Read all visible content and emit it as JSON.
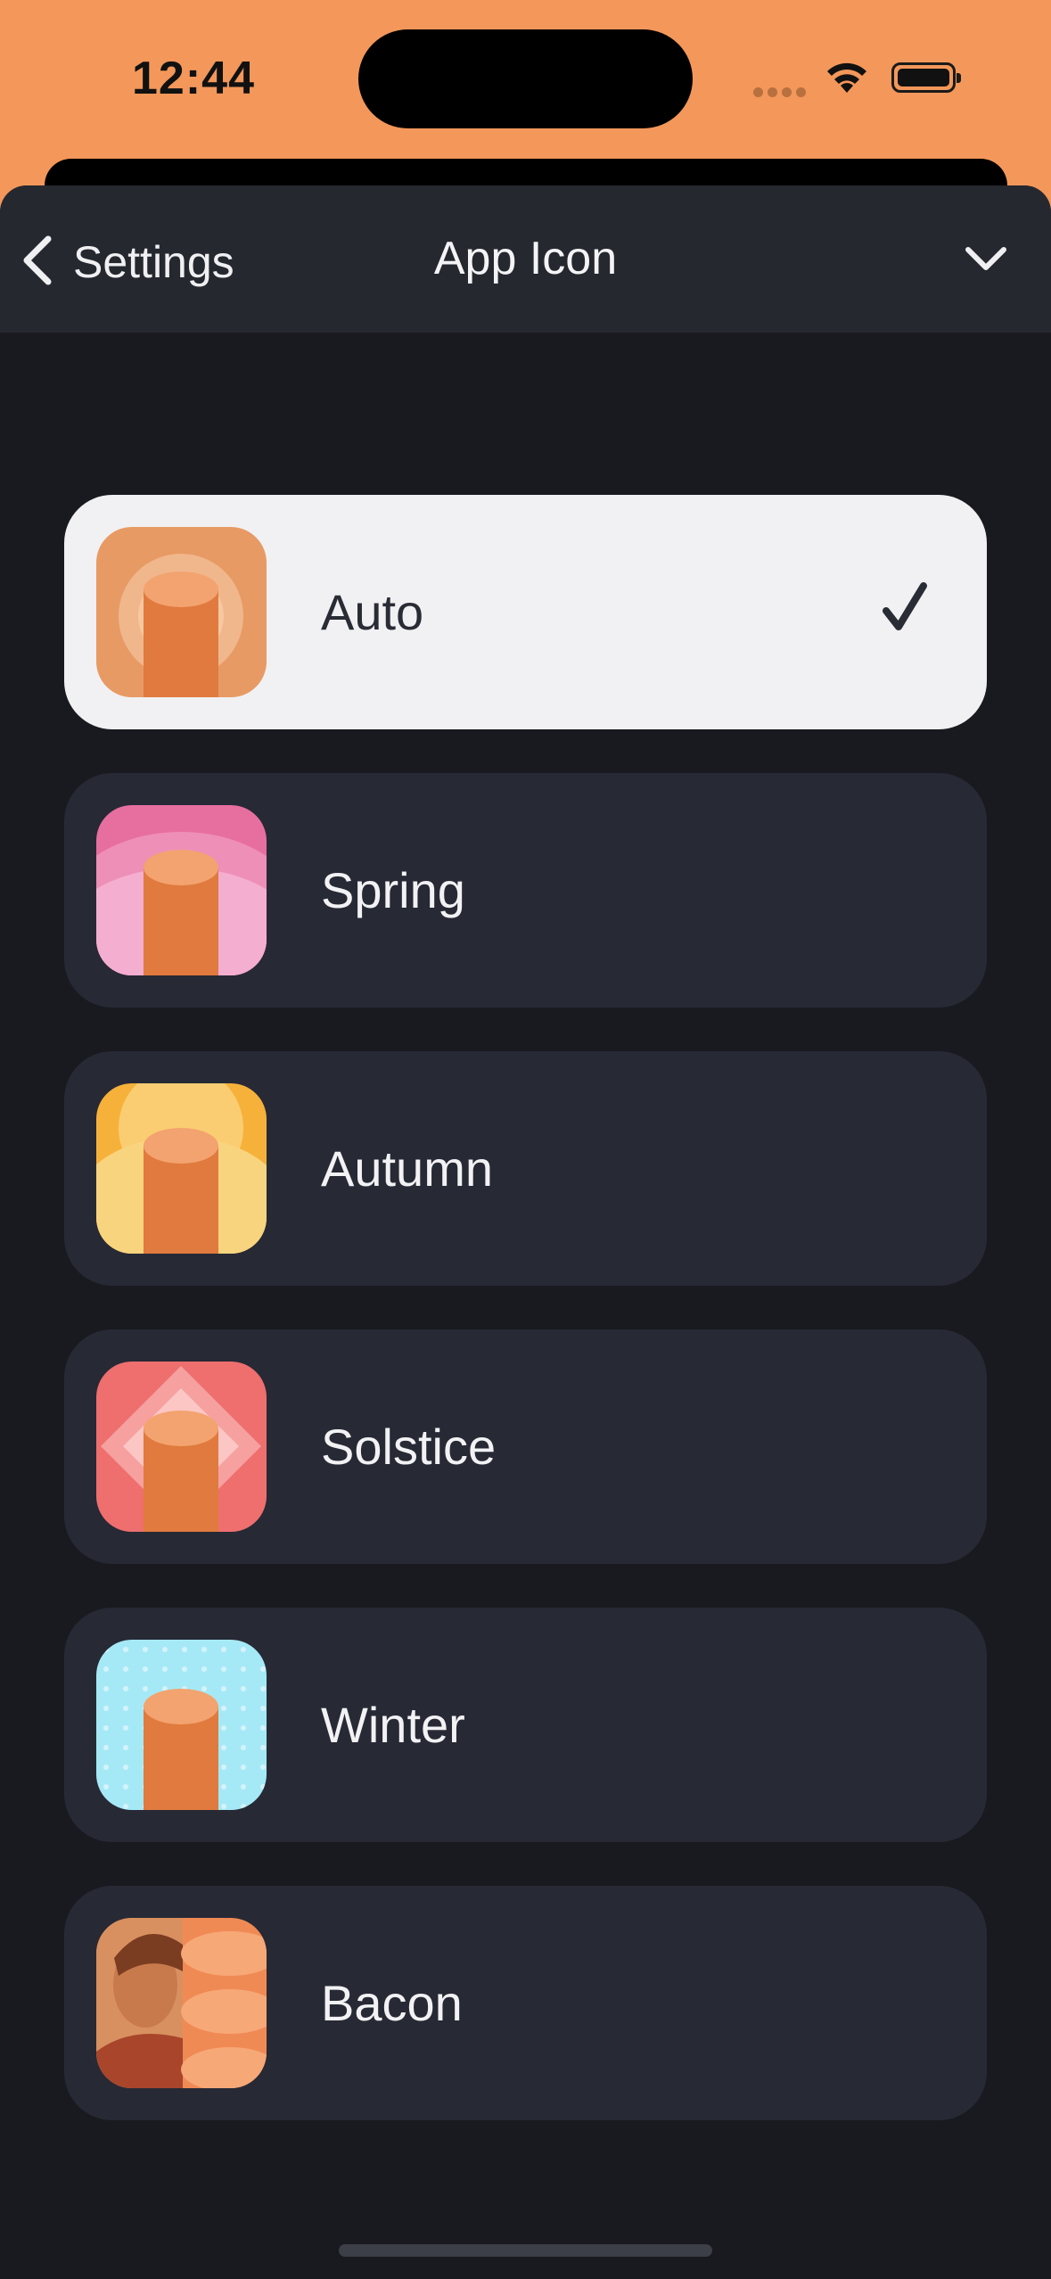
{
  "status_bar": {
    "time": "12:44",
    "icons": [
      "signal-dots-icon",
      "wifi-icon",
      "battery-icon"
    ]
  },
  "nav": {
    "back_label": "Settings",
    "title": "App Icon",
    "back_icon": "chevron-left-icon",
    "collapse_icon": "chevron-down-icon"
  },
  "options": [
    {
      "label": "Auto",
      "selected": true,
      "icon": "auto-app-icon"
    },
    {
      "label": "Spring",
      "selected": false,
      "icon": "spring-app-icon"
    },
    {
      "label": "Autumn",
      "selected": false,
      "icon": "autumn-app-icon"
    },
    {
      "label": "Solstice",
      "selected": false,
      "icon": "solstice-app-icon"
    },
    {
      "label": "Winter",
      "selected": false,
      "icon": "winter-app-icon"
    },
    {
      "label": "Bacon",
      "selected": false,
      "icon": "bacon-app-icon"
    }
  ],
  "colors": {
    "status_bar_bg": "#f3975a",
    "sheet_bg": "#191a1f",
    "navbar_bg": "#262830",
    "row_bg": "#272935",
    "selected_row_bg": "#f1f1f3"
  }
}
